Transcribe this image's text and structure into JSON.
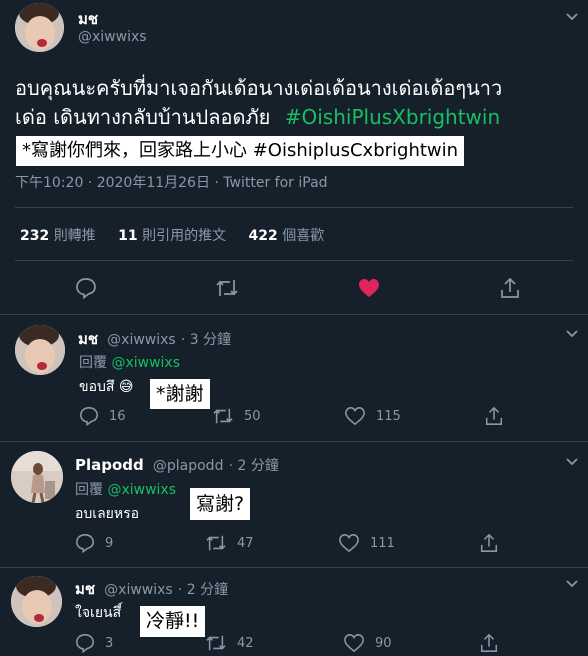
{
  "main_tweet": {
    "author_name": "มช",
    "author_handle": "@xiwwixs",
    "text_line1": "อบคุณนะครับที่มาเจอกันเด้อนางเด่อเด้อนางเด่อเด้อๆนาว",
    "text_line2": "เด่อ เดินทางกลับบ้านปลอดภัย",
    "hashtag": "#OishiPlusXbrightwin",
    "caption": "*寫謝你們來，回家路上小心 #OishiplusCxbrightwin",
    "meta": "下午10:20 · 2020年11月26日 · Twitter for iPad"
  },
  "stats": {
    "retweets_count": "232",
    "retweets_label": "則轉推",
    "quotes_count": "11",
    "quotes_label": "則引用的推文",
    "likes_count": "422",
    "likes_label": "個喜歡"
  },
  "replies": [
    {
      "author_name": "มช",
      "author_handle": "@xiwwixs",
      "time": "· 3 分鐘",
      "reply_prefix": "回覆",
      "reply_to": "@xiwwixs",
      "text": "ขอบสึ",
      "emoji": "😅",
      "caption": "*謝謝",
      "replies_count": "16",
      "retweets_count": "50",
      "likes_count": "115"
    },
    {
      "author_name": "Plapodd",
      "author_handle": "@plapodd",
      "time": "· 2 分鐘",
      "reply_prefix": "回覆",
      "reply_to": "@xiwwixs",
      "text": "อบเลยหรอ",
      "caption": "寫謝?",
      "replies_count": "9",
      "retweets_count": "47",
      "likes_count": "111"
    },
    {
      "author_name": "มช",
      "author_handle": "@xiwwixs",
      "time": "· 2 分鐘",
      "text": "ใจเยนสึ์",
      "caption": "冷靜!!",
      "replies_count": "3",
      "retweets_count": "42",
      "likes_count": "90"
    }
  ],
  "colors": {
    "background": "#15202b",
    "divider": "#38444d",
    "secondary_text": "#8899a6",
    "hashtag": "#17bf63",
    "like_active": "#e0245e"
  },
  "icons": [
    "reply-icon",
    "retweet-icon",
    "like-icon",
    "share-icon",
    "chevron-down-icon"
  ]
}
